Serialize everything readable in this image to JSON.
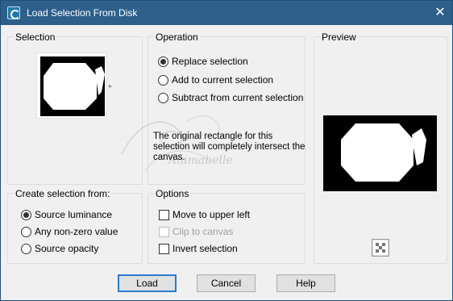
{
  "window": {
    "title": "Load Selection From Disk",
    "close_glyph": "✕"
  },
  "selection_group": {
    "label": "Selection"
  },
  "operation_group": {
    "label": "Operation",
    "options": [
      {
        "label": "Replace selection",
        "checked": true
      },
      {
        "label": "Add to current selection",
        "checked": false
      },
      {
        "label": "Subtract from current selection",
        "checked": false
      }
    ],
    "description": "The original rectangle for this selection will completely intersect the canvas."
  },
  "preview_group": {
    "label": "Preview"
  },
  "create_group": {
    "label": "Create selection from:",
    "options": [
      {
        "label": "Source luminance",
        "checked": true
      },
      {
        "label": "Any non-zero value",
        "checked": false
      },
      {
        "label": "Source opacity",
        "checked": false
      }
    ]
  },
  "options_group": {
    "label": "Options",
    "items": [
      {
        "label": "Move to upper left",
        "checked": false,
        "enabled": true
      },
      {
        "label": "Clip to canvas",
        "checked": false,
        "enabled": false
      },
      {
        "label": "Invert selection",
        "checked": false,
        "enabled": true
      }
    ]
  },
  "watermark": {
    "text": "Animabelle"
  },
  "buttons": {
    "load": "Load",
    "cancel": "Cancel",
    "help": "Help"
  },
  "icons": {
    "app": "selection-disk-icon",
    "close": "close-icon",
    "transparency": "checkerboard-icon"
  }
}
